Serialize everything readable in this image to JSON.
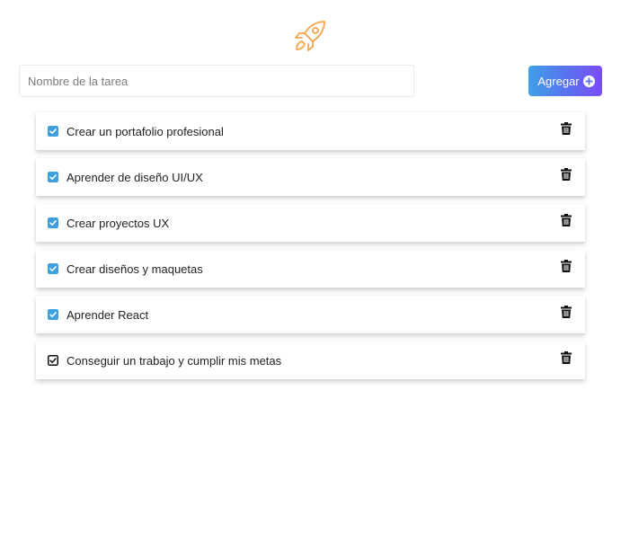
{
  "logo": {
    "icon": "rocket-icon",
    "color": "#f5a44a"
  },
  "form": {
    "placeholder": "Nombre de la tarea",
    "value": "",
    "add_label": "Agregar",
    "add_icon": "plus-circle-icon",
    "button_gradient": [
      "#3fa0e6",
      "#7b4df2"
    ]
  },
  "tasks": [
    {
      "text": "Crear un portafolio profesional",
      "completed": true,
      "style": "filled"
    },
    {
      "text": "Aprender de diseño UI/UX",
      "completed": true,
      "style": "filled"
    },
    {
      "text": "Crear proyectos UX",
      "completed": true,
      "style": "filled"
    },
    {
      "text": "Crear diseños y maquetas",
      "completed": true,
      "style": "filled"
    },
    {
      "text": "Aprender React",
      "completed": true,
      "style": "filled"
    },
    {
      "text": "Conseguir un trabajo y cumplir mis metas",
      "completed": true,
      "style": "outline"
    }
  ],
  "colors": {
    "checkbox_filled": "#3b9fe0",
    "checkbox_outline": "#111111",
    "trash": "#111111"
  },
  "icons": {
    "delete": "trash-icon",
    "check": "check-icon"
  }
}
